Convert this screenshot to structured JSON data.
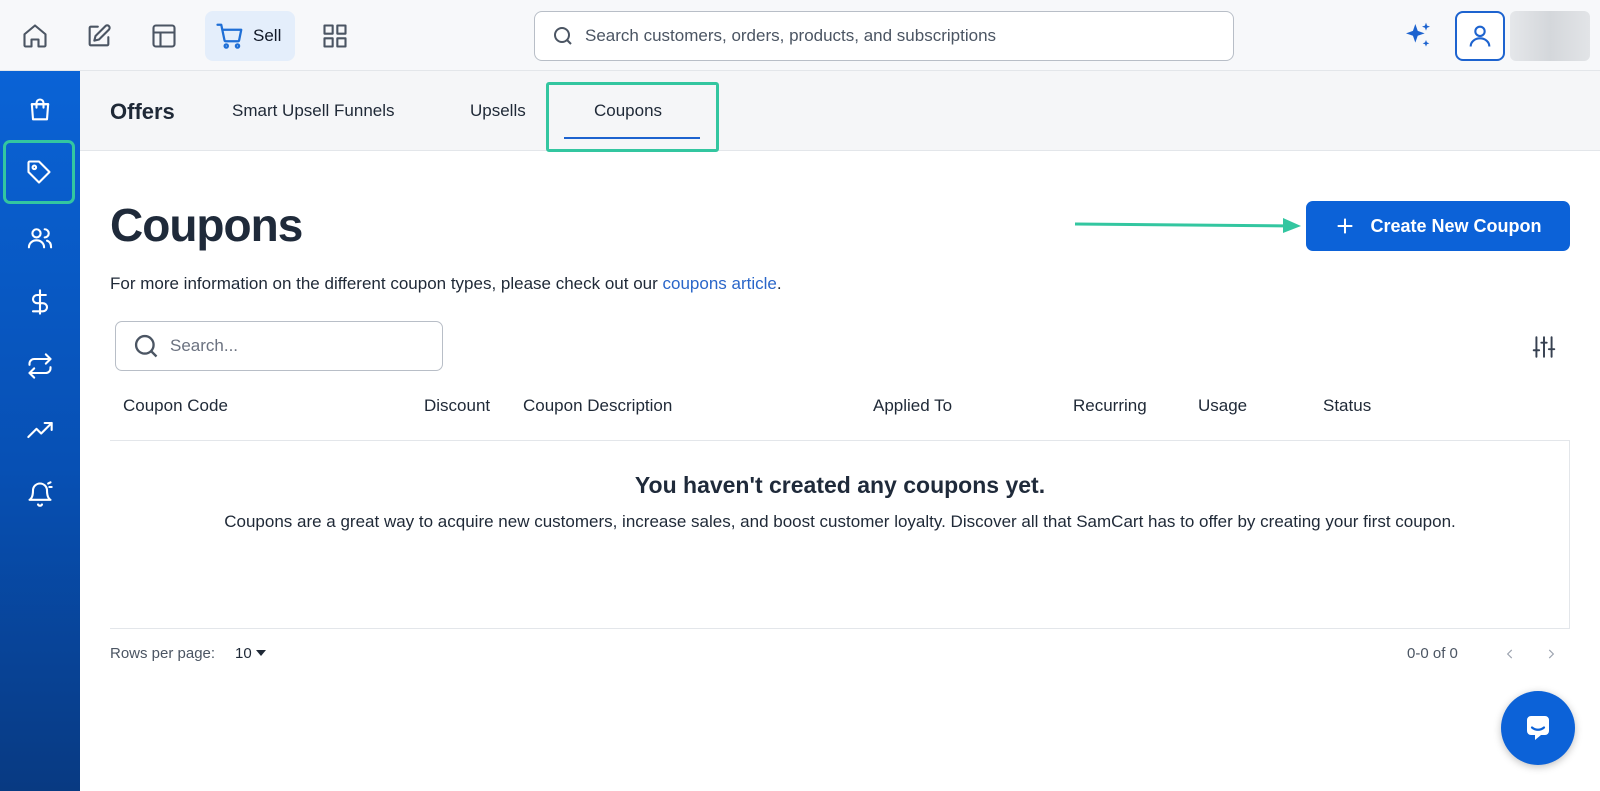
{
  "topbar": {
    "sell_label": "Sell",
    "search_placeholder": "Search customers, orders, products, and subscriptions"
  },
  "subnav": {
    "title": "Offers",
    "tabs": [
      {
        "label": "Smart Upsell Funnels"
      },
      {
        "label": "Upsells"
      },
      {
        "label": "Coupons",
        "active": true
      }
    ]
  },
  "main": {
    "title": "Coupons",
    "info_prefix": "For more information on the different coupon types, please check out our ",
    "info_link": "coupons article",
    "info_suffix": ".",
    "create_button": "Create New Coupon",
    "search_placeholder": "Search...",
    "columns": [
      "Coupon Code",
      "Discount",
      "Coupon Description",
      "Applied To",
      "Recurring",
      "Usage",
      "Status"
    ],
    "empty_title": "You haven't created any coupons yet.",
    "empty_desc": "Coupons are a great way to acquire new customers, increase sales, and boost customer loyalty. Discover all that SamCart has to offer by creating your first coupon."
  },
  "pagination": {
    "rows_label": "Rows per page:",
    "rows_value": "10",
    "count": "0-0 of 0"
  },
  "sidebar": {
    "items": [
      {
        "icon": "shopping-bag-icon"
      },
      {
        "icon": "tag-icon",
        "active": true
      },
      {
        "icon": "users-icon"
      },
      {
        "icon": "dollar-icon"
      },
      {
        "icon": "repeat-icon"
      },
      {
        "icon": "trending-up-icon"
      },
      {
        "icon": "bell-icon"
      }
    ]
  },
  "colors": {
    "primary": "#0c62d8",
    "highlight": "#33c6a0",
    "link": "#2a66c9"
  }
}
